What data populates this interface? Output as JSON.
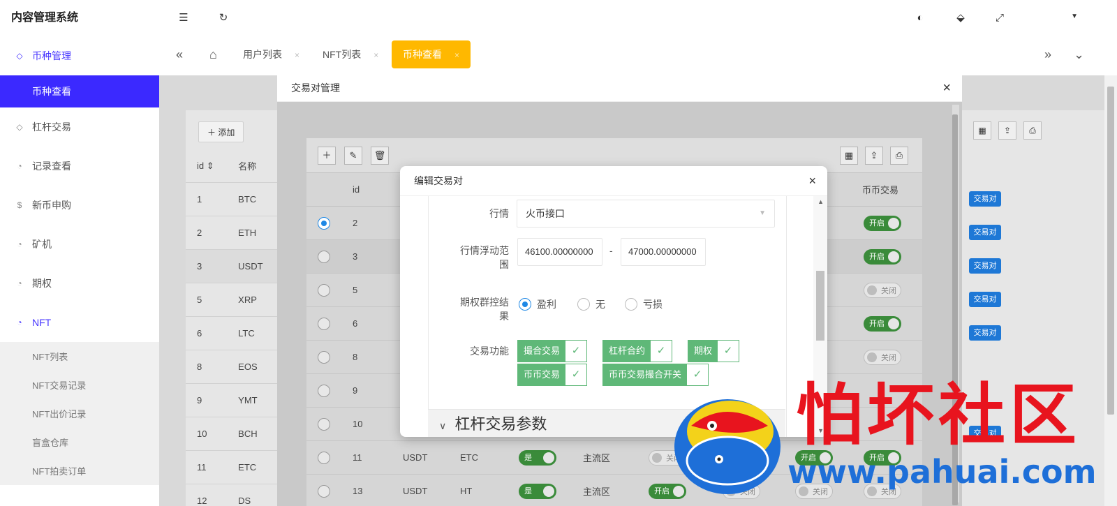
{
  "app": {
    "title": "内容管理系统"
  },
  "sidebar": {
    "items": [
      {
        "label": "币种管理",
        "icon": "diamond-icon"
      },
      {
        "label": "杠杆交易",
        "icon": "diamond-icon"
      },
      {
        "label": "记录查看",
        "icon": "clock-icon"
      },
      {
        "label": "新币申购",
        "icon": "dollar-icon"
      },
      {
        "label": "矿机",
        "icon": "clock-icon"
      },
      {
        "label": "期权",
        "icon": "clock-icon"
      },
      {
        "label": "NFT",
        "icon": "clock-icon"
      }
    ],
    "active_sub": "币种查看",
    "nft_sub": [
      "NFT列表",
      "NFT交易记录",
      "NFT出价记录",
      "盲盒仓库",
      "NFT拍卖订单"
    ]
  },
  "tabs": {
    "items": [
      {
        "label": "用户列表"
      },
      {
        "label": "NFT列表"
      },
      {
        "label": "币种查看"
      }
    ]
  },
  "main": {
    "add_label": "添加",
    "columns": [
      "id",
      "名称"
    ],
    "rows": [
      [
        "1",
        "BTC"
      ],
      [
        "2",
        "ETH"
      ],
      [
        "3",
        "USDT"
      ],
      [
        "5",
        "XRP"
      ],
      [
        "6",
        "LTC"
      ],
      [
        "8",
        "EOS"
      ],
      [
        "9",
        "YMT"
      ],
      [
        "10",
        "BCH"
      ],
      [
        "11",
        "ETC"
      ],
      [
        "12",
        "DS"
      ]
    ],
    "pair_badge": "交易对"
  },
  "outer_modal": {
    "title": "交易对管理",
    "col_id": "id",
    "col_coin_trade": "币币交易",
    "rows": [
      {
        "id": "2"
      },
      {
        "id": "3"
      },
      {
        "id": "5"
      },
      {
        "id": "6"
      },
      {
        "id": "8"
      },
      {
        "id": "9"
      },
      {
        "id": "10"
      },
      {
        "id": "11",
        "quote": "USDT",
        "base": "ETC",
        "yes": "是",
        "zone": "主流区"
      },
      {
        "id": "13",
        "quote": "USDT",
        "base": "HT",
        "yes": "是",
        "zone": "主流区"
      }
    ],
    "toggle_on": "开启",
    "toggle_off": "关闭"
  },
  "dialog": {
    "title": "编辑交易对",
    "market_label": "行情",
    "market_value": "火币接口",
    "range_label_1": "行情浮动范",
    "range_label_2": "围",
    "range_min": "46100.00000000",
    "range_max": "47000.00000000",
    "range_sep": "-",
    "option_label_1": "期权群控结",
    "option_label_2": "果",
    "option_choices": [
      "盈利",
      "无",
      "亏损"
    ],
    "func_label": "交易功能",
    "functions": [
      "撮合交易",
      "杠杆合约",
      "期权",
      "币币交易",
      "币币交易撮合开关"
    ],
    "lever_section": "杠杆交易参数"
  },
  "watermark": {
    "title": "怕坏社区",
    "url": "www.pahuai.com"
  },
  "colors": {
    "accent": "#3b29ff",
    "tab_active": "#ffb800",
    "check_green": "#5fb878",
    "badge_blue": "#1e78d6"
  }
}
